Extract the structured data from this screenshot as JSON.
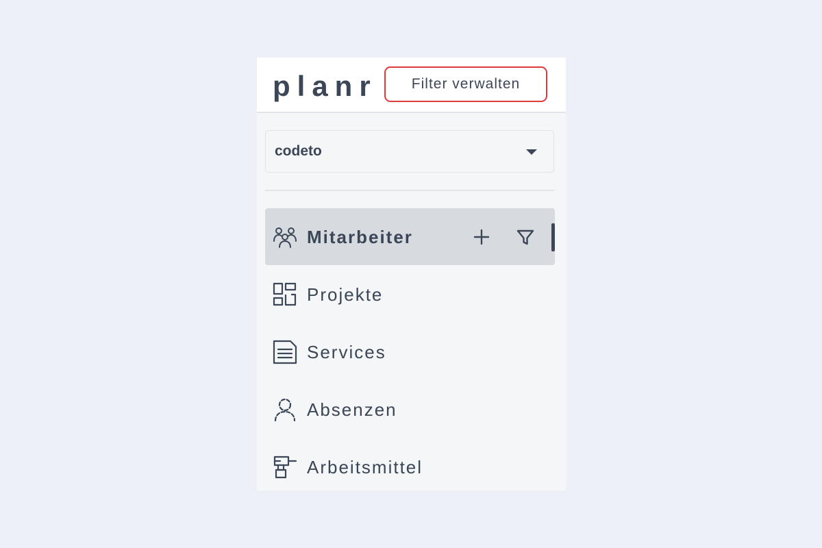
{
  "header": {
    "logo": "planr",
    "filter_button": "Filter verwalten"
  },
  "workspace_select": {
    "value": "codeto"
  },
  "nav": [
    {
      "label": "Mitarbeiter",
      "icon": "people-icon",
      "active": true
    },
    {
      "label": "Projekte",
      "icon": "dashboard-icon",
      "active": false
    },
    {
      "label": "Services",
      "icon": "document-icon",
      "active": false
    },
    {
      "label": "Absenzen",
      "icon": "person-dashed-icon",
      "active": false
    },
    {
      "label": "Arbeitsmittel",
      "icon": "drill-icon",
      "active": false
    }
  ],
  "colors": {
    "page_background": "#edf0f7",
    "panel_background": "#f5f6f8",
    "text": "#3b4656",
    "active_item": "#d7dbe0",
    "highlight_border": "#e03b3b"
  }
}
